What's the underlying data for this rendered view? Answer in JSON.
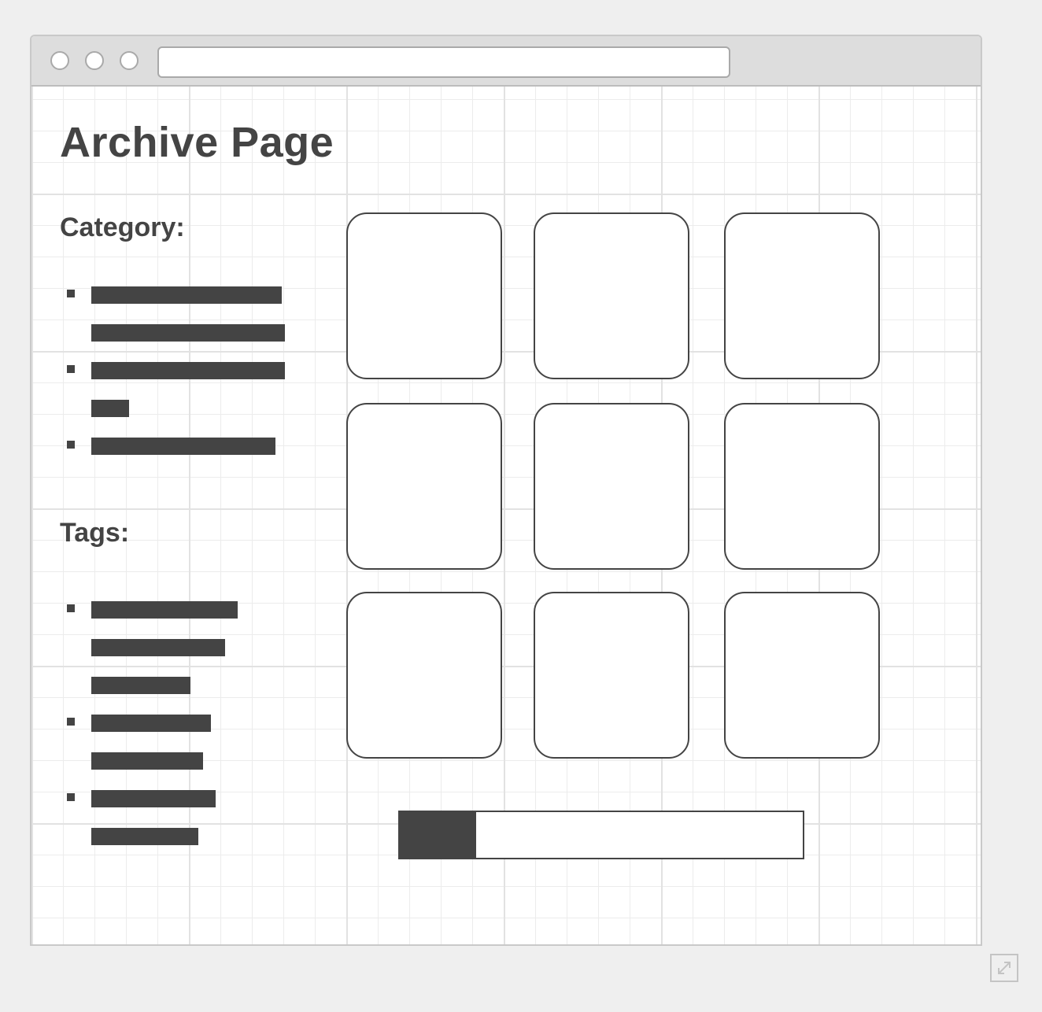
{
  "page": {
    "title": "Archive Page"
  },
  "window": {
    "controls": [
      "window-button",
      "window-button",
      "window-button"
    ],
    "address_bar_value": ""
  },
  "sidebar": {
    "category_label": "Category:",
    "category_items": [
      {
        "lines": 2
      },
      {
        "lines": 2
      },
      {
        "lines": 1
      }
    ],
    "tags_label": "Tags:",
    "tag_items": [
      {
        "lines": 3
      },
      {
        "lines": 2
      },
      {
        "lines": 2
      }
    ]
  },
  "grid": {
    "rows": 3,
    "columns": 3,
    "card_count": 9
  },
  "pagination": {
    "progress_fraction": 0.19
  },
  "icons": {
    "expand": "expand-icon"
  },
  "colors": {
    "ink": "#444444",
    "background": "#efefef",
    "chrome": "#dddddd"
  }
}
